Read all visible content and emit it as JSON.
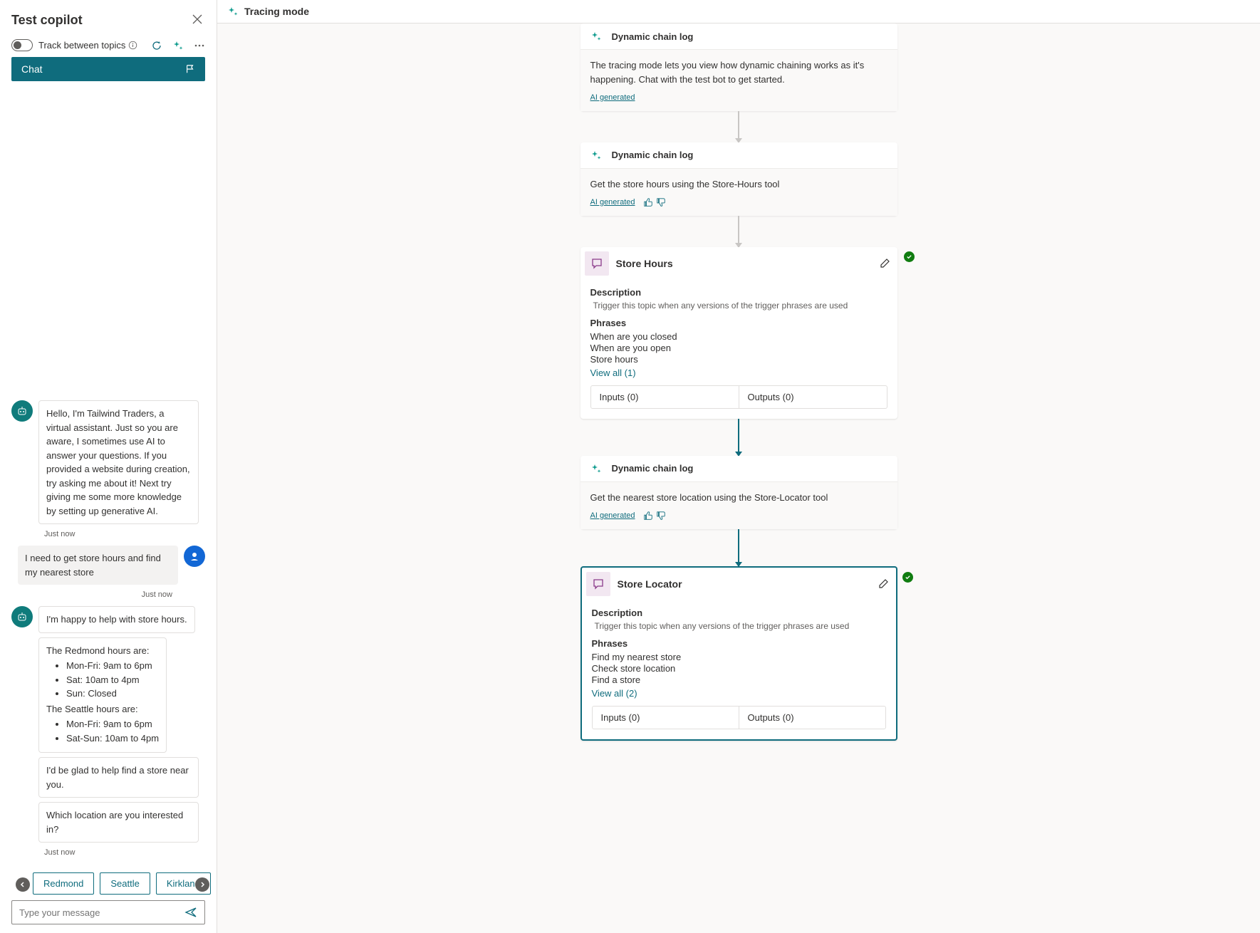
{
  "panel": {
    "title": "Test copilot",
    "track_label": "Track between topics",
    "chat_tab": "Chat"
  },
  "messages": {
    "bot_intro": "Hello, I'm Tailwind Traders, a virtual assistant. Just so you are aware, I sometimes use AI to answer your questions. If you provided a website during creation, try asking me about it! Next try giving me some more knowledge by setting up generative AI.",
    "ts1": "Just now",
    "user_msg": "I need to get store hours and find my nearest store",
    "ts2": "Just now",
    "bot_help": "I'm happy to help with store hours.",
    "redmond_intro": "The Redmond hours are:",
    "redmond_h1": "Mon-Fri: 9am to 6pm",
    "redmond_h2": "Sat: 10am to 4pm",
    "redmond_h3": "Sun: Closed",
    "seattle_intro": "The Seattle hours are:",
    "seattle_h1": "Mon-Fri: 9am to 6pm",
    "seattle_h2": "Sat-Sun: 10am to 4pm",
    "bot_glad": "I'd be glad to help find a store near you.",
    "bot_which": "Which location are you interested in?",
    "ts3": "Just now"
  },
  "suggestions": [
    "Redmond",
    "Seattle",
    "Kirkland"
  ],
  "input_placeholder": "Type your message",
  "canvas_header": "Tracing mode",
  "cards": {
    "log1": {
      "title": "Dynamic chain log",
      "text": "The tracing mode lets you view how dynamic chaining works as it's happening. Chat with the test bot to get started.",
      "ai": "AI generated"
    },
    "log2": {
      "title": "Dynamic chain log",
      "text": "Get the store hours using the Store-Hours tool",
      "ai": "AI generated"
    },
    "topic1": {
      "title": "Store Hours",
      "desc_label": "Description",
      "desc_text": "Trigger this topic when any versions of the trigger phrases are used",
      "phrases_label": "Phrases",
      "phrases": [
        "When are you closed",
        "When are you open",
        "Store hours"
      ],
      "view_all": "View all (1)",
      "inputs": "Inputs (0)",
      "outputs": "Outputs (0)"
    },
    "log3": {
      "title": "Dynamic chain log",
      "text": "Get the nearest store location using the Store-Locator tool",
      "ai": "AI generated"
    },
    "topic2": {
      "title": "Store Locator",
      "desc_label": "Description",
      "desc_text": "Trigger this topic when any versions of the trigger phrases are used",
      "phrases_label": "Phrases",
      "phrases": [
        "Find my nearest store",
        "Check store location",
        "Find a store"
      ],
      "view_all": "View all (2)",
      "inputs": "Inputs (0)",
      "outputs": "Outputs (0)"
    }
  }
}
